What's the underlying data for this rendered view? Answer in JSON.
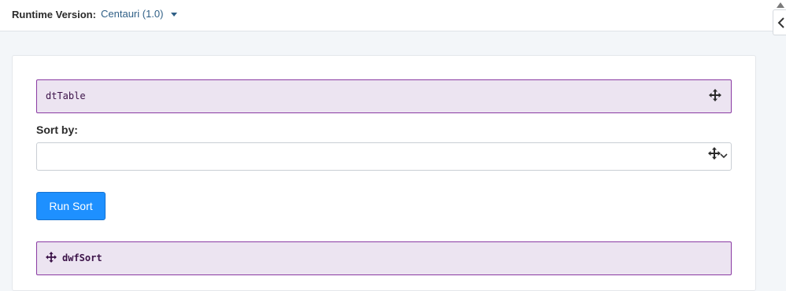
{
  "header": {
    "runtime_label": "Runtime Version:",
    "runtime_value": "Centauri (1.0)",
    "runtime_caret_icon": "caret-down-icon",
    "collapse_icon": "chevron-left-icon"
  },
  "form": {
    "dt_table_label": "dtTable",
    "sort_by_label": "Sort by:",
    "sort_value": "",
    "run_button_label": "Run Sort",
    "dwf_sort_label": "dwfSort",
    "move_icon": "move-icon"
  },
  "colors": {
    "accent_button": "#1e90ff",
    "component_bg": "#ece4f1",
    "component_border": "#8a3aa3"
  }
}
